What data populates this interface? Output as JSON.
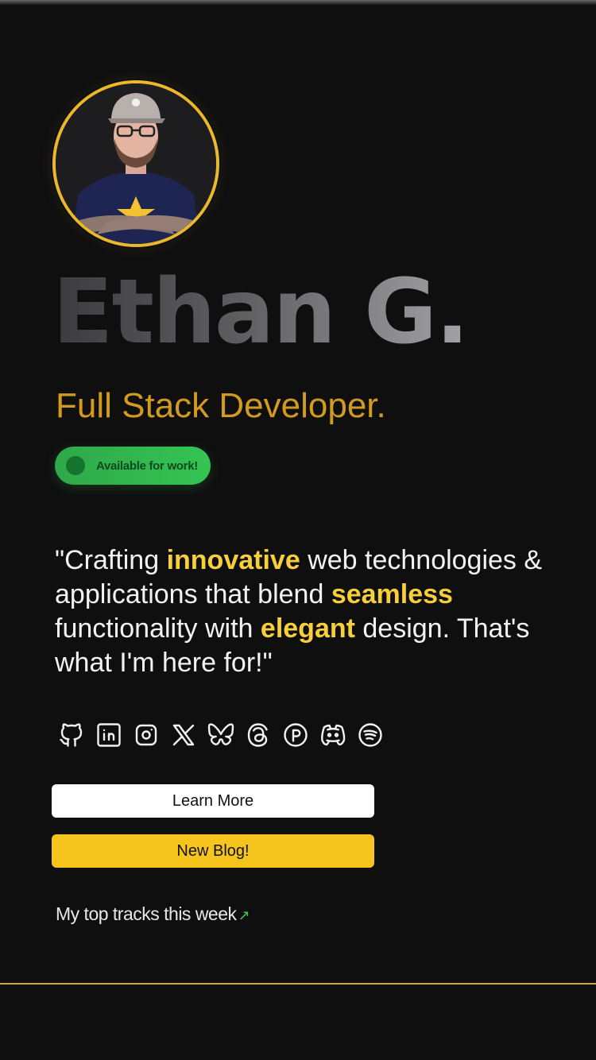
{
  "profile": {
    "name": "Ethan G.",
    "role": "Full Stack Developer.",
    "status": "Available for work!",
    "avatar_alt": "profile photo"
  },
  "quote": {
    "p1": "\"Crafting ",
    "h1": "innovative",
    "p2": " web technologies & applications that blend ",
    "h2": "seamless",
    "p3": " functionality with ",
    "h3": "elegant",
    "p4": " design. That's what I'm here for!\""
  },
  "socials": [
    {
      "icon": "github-icon"
    },
    {
      "icon": "linkedin-icon"
    },
    {
      "icon": "instagram-icon"
    },
    {
      "icon": "x-icon"
    },
    {
      "icon": "bluesky-icon"
    },
    {
      "icon": "threads-icon"
    },
    {
      "icon": "patreon-icon"
    },
    {
      "icon": "discord-icon"
    },
    {
      "icon": "spotify-icon"
    }
  ],
  "buttons": {
    "learn_more": "Learn More",
    "new_blog": "New Blog!"
  },
  "tracks": {
    "label": "My top tracks this week",
    "arrow": "↗"
  },
  "colors": {
    "background": "#0f0f10",
    "accent_gold": "#d29b1f",
    "highlight_yellow": "#f7cf3a",
    "status_green": "#2fa84a",
    "blog_button": "#f5c51d"
  }
}
